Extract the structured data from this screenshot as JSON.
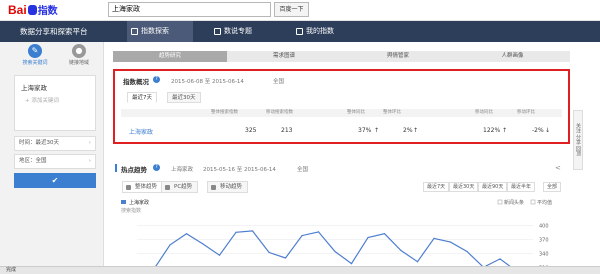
{
  "header": {
    "logo_text": "Bai",
    "logo_cn": "指数",
    "search_value": "上海家政",
    "search_button": "百度一下"
  },
  "nav": {
    "platform_title": "数据分享和探索平台",
    "tabs": [
      "指数探索",
      "数说专题",
      "我的指数"
    ]
  },
  "sidebar": {
    "icon_tabs": [
      "搜索关键词",
      "链接地域"
    ],
    "keyword": "上海家政",
    "add_keyword": "+ 添加关键词",
    "time_filter": "时间：最近30天",
    "region_filter": "地区：全国",
    "confirm_icon": "check-icon"
  },
  "subtabs": [
    "趋势研究",
    "需求图谱",
    "舆情管家",
    "人群画像"
  ],
  "index_overview": {
    "title": "指数概况",
    "date_range": "2015-06-08 至 2015-06-14",
    "region": "全国",
    "period_tabs": [
      "最近7天",
      "最近30天"
    ],
    "columns": [
      "整体搜索指数",
      "移动搜索指数",
      "整体同比",
      "整体环比",
      "移动同比",
      "移动环比"
    ],
    "rows": [
      {
        "keyword": "上海家政",
        "overall": "325",
        "mobile": "213",
        "overall_yoy": "37%",
        "overall_mom": "2%",
        "mobile_yoy": "122%",
        "mobile_mom": "-2%"
      }
    ]
  },
  "trend": {
    "title": "热点趋势",
    "keyword": "上海家政",
    "date_range": "2015-05-16 至 2015-06-14",
    "region": "全国",
    "tabs": [
      "整体趋势",
      "PC趋势",
      "移动趋势"
    ],
    "range_buttons": [
      "最近7天",
      "最近30天",
      "最近90天",
      "最近半年",
      "全部"
    ],
    "legend_keyword": "上海家政",
    "options": [
      "新闻头条",
      "平均值"
    ],
    "chart_label": "搜索指数"
  },
  "chart_data": {
    "type": "line",
    "title": "",
    "ylabel": "搜索指数",
    "ylim": [
      300,
      420
    ],
    "yticks": [
      310,
      340,
      370,
      400
    ],
    "series": [
      {
        "name": "上海家政",
        "values": [
          300,
          305,
          358,
          382,
          360,
          336,
          385,
          388,
          342,
          330,
          378,
          386,
          344,
          318,
          374,
          382,
          346,
          322,
          372,
          364,
          344,
          310,
          328,
          302,
          300
        ]
      }
    ],
    "grid": true,
    "legend": "top-left"
  },
  "right_panel": "关注 分享 回顶",
  "status_text": "完成",
  "colors": {
    "accent": "#3c7ed0",
    "nav": "#2d3e5a",
    "highlight": "#e02020",
    "line": "#4e7ed0"
  }
}
